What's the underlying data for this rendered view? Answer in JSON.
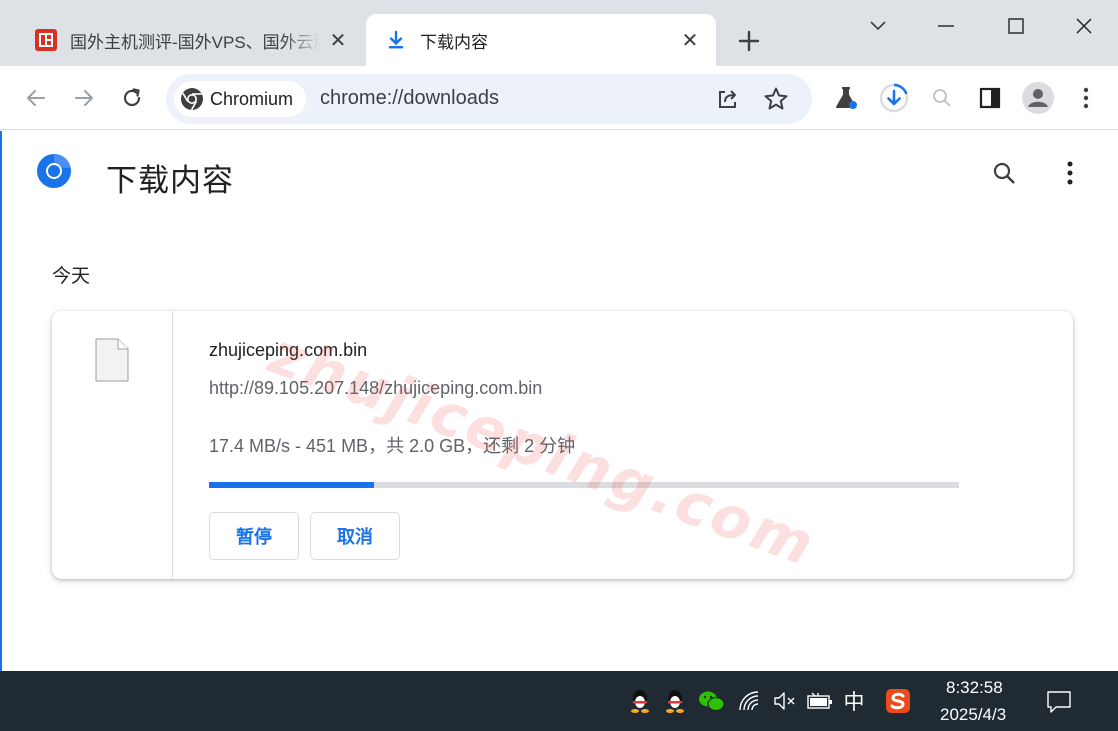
{
  "tabs": [
    {
      "title": "国外主机测评-国外VPS、国外云服务器",
      "close_label": "✕",
      "active": false
    },
    {
      "title": "下载内容",
      "close_label": "✕",
      "active": true
    }
  ],
  "toolbar": {
    "chip_label": "Chromium",
    "url": "chrome://downloads"
  },
  "page": {
    "title": "下载内容",
    "date_header": "今天",
    "watermark": "zhujiceping.com"
  },
  "download": {
    "file_name": "zhujiceping.com.bin",
    "url": "http://89.105.207.148/zhujiceping.com.bin",
    "status": "17.4 MB/s - 451 MB，共 2.0 GB，还剩 2 分钟",
    "progress": 0.22,
    "pause_label": "暂停",
    "cancel_label": "取消"
  },
  "taskbar": {
    "ime": "中",
    "time": "8:32:58",
    "date": "2025/4/3"
  },
  "colors": {
    "accent": "#1a73e8",
    "tabstrip": "#dee1e6",
    "omnibox": "#edf2fa",
    "taskbar": "#1f2a33",
    "watermark": "#eb4646"
  },
  "icons": [
    "site-favicon",
    "download-icon",
    "plus-icon",
    "chevron-down-icon",
    "minimize-icon",
    "maximize-icon",
    "close-icon",
    "back-icon",
    "forward-icon",
    "reload-icon",
    "chromium-icon",
    "share-icon",
    "star-icon",
    "labs-icon",
    "download-progress-icon",
    "zoom-icon",
    "side-panel-icon",
    "profile-icon",
    "menu-icon",
    "search-icon",
    "more-icon",
    "file-icon",
    "qq-icon",
    "wechat-icon",
    "wifi-icon",
    "volume-muted-icon",
    "battery-icon",
    "sogou-icon",
    "notification-icon"
  ]
}
